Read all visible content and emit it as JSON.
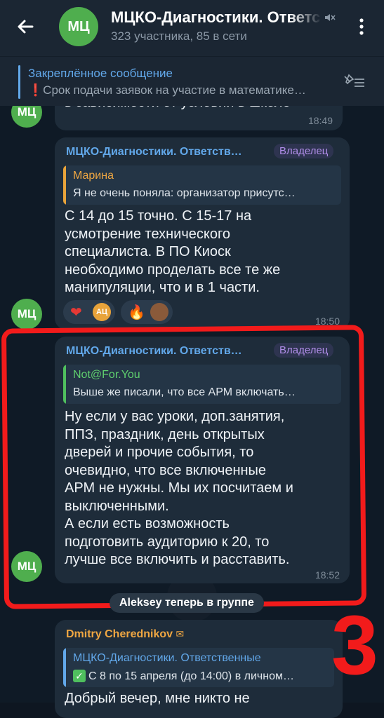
{
  "header": {
    "avatar_initials": "МЦ",
    "title": "МЦКО-Диагностики. Ответственные",
    "subtitle": "323 участника, 85 в сети"
  },
  "pinned": {
    "title": "Закреплённое сообщение",
    "text": "Срок подачи заявок на участие в математике…"
  },
  "messages": {
    "prev_partial": {
      "text": "в зависимости от условий в школе",
      "time": "18:49",
      "avatar": "МЦ"
    },
    "msg1": {
      "sender": "МЦКО-Диагностики. Ответств…",
      "badge": "Владелец",
      "reply_name": "Марина",
      "reply_text": "Я не очень поняла: организатор присутс…",
      "text": "С 14 до 15 точно. С 15-17 на\nусмотрение технического\nспециалиста. В ПО Киоск\nнеобходимо проделать все те же\nманипуляции, что и в 1 части.",
      "time": "18:50",
      "avatar": "МЦ",
      "reaction1": {
        "emoji": "❤️",
        "avatar": "АЦ"
      },
      "reaction2": {
        "emoji": "🔥"
      }
    },
    "msg2": {
      "sender": "МЦКО-Диагностики. Ответств…",
      "badge": "Владелец",
      "reply_name": "Not@For.You",
      "reply_text": "Выше же писали, что все АРМ включать…",
      "text": "Ну если у вас уроки, доп.занятия,\nППЗ, праздник, день открытых\nдверей и прочие события, то\nочевидно, что все включенные\nАРМ не нужны. Мы их посчитаем и\nвыключенными.\nА если есть возможность\nподготовить аудиторию к 20, то\nлучше все включить и расставить.",
      "time": "18:52",
      "avatar": "МЦ"
    },
    "service": "Aleksey теперь в группе",
    "msg3": {
      "sender": "Dmitry Cherednikov",
      "reply_name": "МЦКО-Диагностики. Ответственные",
      "reply_text": "С 8 по 15 апреля (до 14:00) в личном…",
      "text": "Добрый вечер, мне никто не"
    }
  },
  "annotation": "3",
  "colors": {
    "accent": "#62a8ea",
    "owner": "#b08de8",
    "avatar_bg": "#4fae4e",
    "highlight": "#f21b1b"
  }
}
